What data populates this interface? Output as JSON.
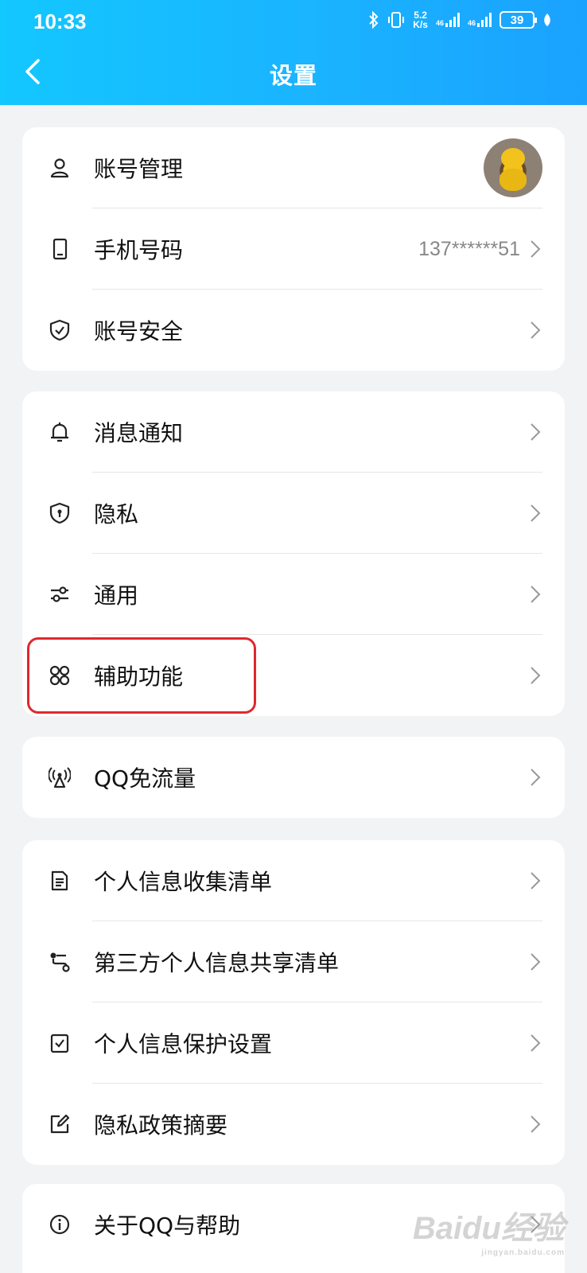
{
  "status_bar": {
    "time": "10:33",
    "speed_value": "5.2",
    "speed_unit": "K/s",
    "net1": "46",
    "net2": "46",
    "battery": "39"
  },
  "header": {
    "title": "设置"
  },
  "groups": [
    {
      "items": [
        {
          "label": "账号管理",
          "icon": "person-icon"
        },
        {
          "label": "手机号码",
          "value": "137******51",
          "icon": "phone-icon"
        },
        {
          "label": "账号安全",
          "icon": "shield-check-icon"
        }
      ]
    },
    {
      "items": [
        {
          "label": "消息通知",
          "icon": "bell-icon"
        },
        {
          "label": "隐私",
          "icon": "shield-lock-icon"
        },
        {
          "label": "通用",
          "icon": "sliders-icon"
        },
        {
          "label": "辅助功能",
          "icon": "grid-icon"
        }
      ]
    },
    {
      "items": [
        {
          "label": "QQ免流量",
          "icon": "signal-tower-icon"
        }
      ]
    },
    {
      "items": [
        {
          "label": "个人信息收集清单",
          "icon": "document-icon"
        },
        {
          "label": "第三方个人信息共享清单",
          "icon": "share-icon"
        },
        {
          "label": "个人信息保护设置",
          "icon": "checkbox-icon"
        },
        {
          "label": "隐私政策摘要",
          "icon": "edit-icon"
        }
      ]
    },
    {
      "items": [
        {
          "label": "关于QQ与帮助",
          "icon": "info-icon"
        }
      ]
    }
  ],
  "watermark": {
    "logo": "Baidu经验",
    "url": "jingyan.baidu.com"
  },
  "colors": {
    "header_gradient_start": "#13c7ff",
    "header_gradient_end": "#1aa2ff",
    "highlight": "#e0282e"
  }
}
